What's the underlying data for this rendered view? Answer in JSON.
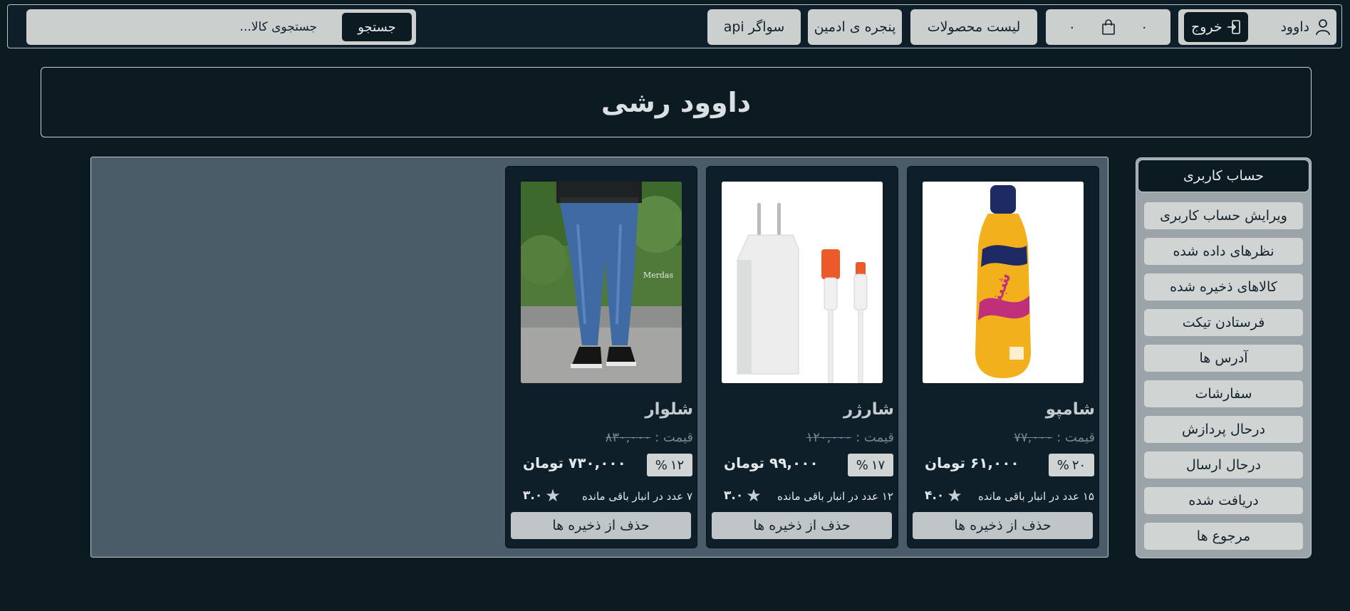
{
  "navbar": {
    "user_name": "داوود",
    "user_icon": "user-icon",
    "logout_label": "خروج",
    "logout_icon": "logout-icon",
    "cart_count": "۰",
    "cart_icon": "shopping-bag-icon",
    "cart_total": "۰",
    "products_label": "لیست محصولات",
    "admin_label": "پنجره ی ادمین",
    "swagger_label": "سواگر api",
    "search_placeholder": "جستجوی کالا...",
    "search_button": "جستجو"
  },
  "banner": {
    "title": "داوود رشی"
  },
  "sidebar": {
    "title": "حساب کاربری",
    "items": [
      {
        "label": "ویرایش حساب کاربری"
      },
      {
        "label": "نظرهای داده شده"
      },
      {
        "label": "کالاهای ذخیره شده"
      },
      {
        "label": "فرستادن تیکت"
      },
      {
        "label": "آدرس ها"
      },
      {
        "label": "سفارشات"
      },
      {
        "label": "درحال پردازش"
      },
      {
        "label": "درحال ارسال"
      },
      {
        "label": "دریافت شده"
      },
      {
        "label": "مرجوع ها"
      }
    ]
  },
  "products": [
    {
      "name": "شامپو",
      "old_price_label": "قیمت :",
      "old_price": "۷۷,۰۰۰",
      "discount_value": "۲۰",
      "discount_sign": "%",
      "price": "۶۱,۰۰۰ تومان",
      "stock": "۱۵ عدد در انبار باقی مانده",
      "rating": "۴.۰",
      "remove_label": "حذف از ذخیره ها"
    },
    {
      "name": "شارژر",
      "old_price_label": "قیمت :",
      "old_price": "۱۲۰,۰۰۰",
      "discount_value": "۱۷",
      "discount_sign": "%",
      "price": "۹۹,۰۰۰ تومان",
      "stock": "۱۲ عدد در انبار باقی مانده",
      "rating": "۳.۰",
      "remove_label": "حذف از ذخیره ها"
    },
    {
      "name": "شلوار",
      "old_price_label": "قیمت :",
      "old_price": "۸۳۰,۰۰۰",
      "discount_value": "۱۲",
      "discount_sign": "%",
      "price": "۷۳۰,۰۰۰ تومان",
      "stock": "۷ عدد در انبار باقی مانده",
      "rating": "۳.۰",
      "remove_label": "حذف از ذخیره ها"
    }
  ],
  "images": {
    "shampoo_brand_text": "شبنم",
    "jeans_brand_text": "Merdas"
  },
  "colors": {
    "background": "#0c1a22",
    "panel": "#4b5c69",
    "card": "#0f1f29",
    "light_button": "#cbd0cf"
  }
}
